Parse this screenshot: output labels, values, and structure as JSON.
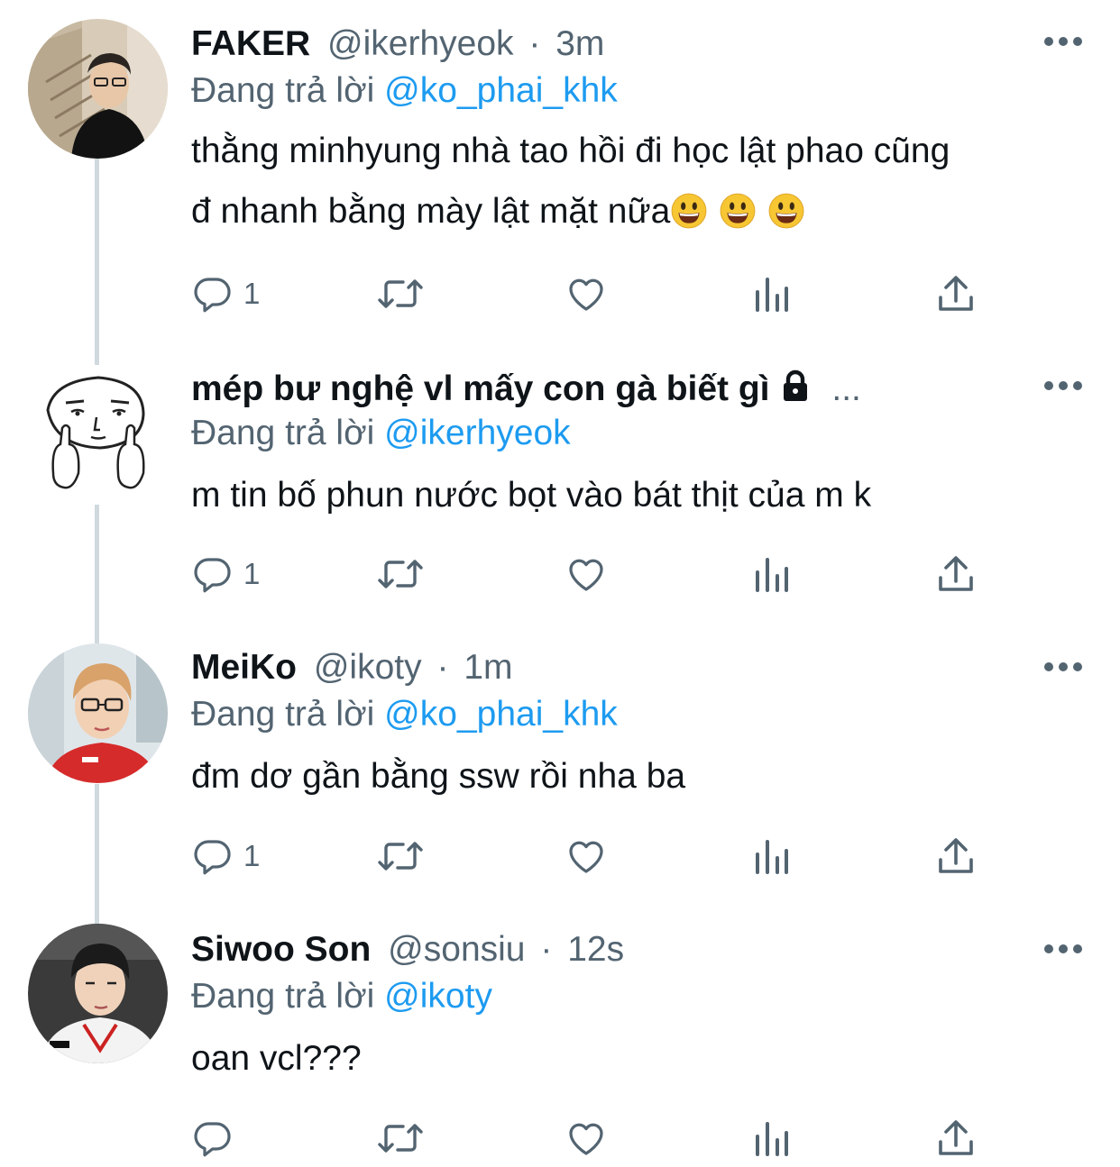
{
  "tweets": [
    {
      "name": "FAKER",
      "handle": "@ikerhyeok",
      "time": "3m",
      "replying_label": "Đang trả lời",
      "replying_to": "@ko_phai_khk",
      "text_line1": "thằng minhyung nhà tao hồi đi học lật phao cũng",
      "text_line2": "đ nhanh bằng mày lật mặt nữa",
      "reply_count": "1"
    },
    {
      "name": "mép bư nghệ vl mấy con gà biết gì",
      "ellipsis": "...",
      "replying_label": "Đang trả lời",
      "replying_to": "@ikerhyeok",
      "text_line1": "m tin bố phun nước bọt vào bát thịt của m k",
      "reply_count": "1"
    },
    {
      "name": "MeiKo",
      "handle": "@ikoty",
      "time": "1m",
      "replying_label": "Đang trả lời",
      "replying_to": "@ko_phai_khk",
      "text_line1": "đm dơ gần bằng ssw rồi nha ba",
      "reply_count": "1"
    },
    {
      "name": "Siwoo Son",
      "handle": "@sonsiu",
      "time": "12s",
      "replying_label": "Đang trả lời",
      "replying_to": "@ikoty",
      "text_line1": "oan vcl???",
      "reply_count": ""
    }
  ],
  "separator": "·",
  "icons": {
    "reply": "reply-icon",
    "retweet": "retweet-icon",
    "like": "heart-icon",
    "views": "analytics-icon",
    "share": "share-icon",
    "more": "more-icon",
    "lock": "lock-icon",
    "emoji": "grinning-face-emoji"
  },
  "colors": {
    "link": "#1d9bf0",
    "secondary": "#536471",
    "primary_text": "#0f1419",
    "thread_line": "#cfd9de"
  }
}
